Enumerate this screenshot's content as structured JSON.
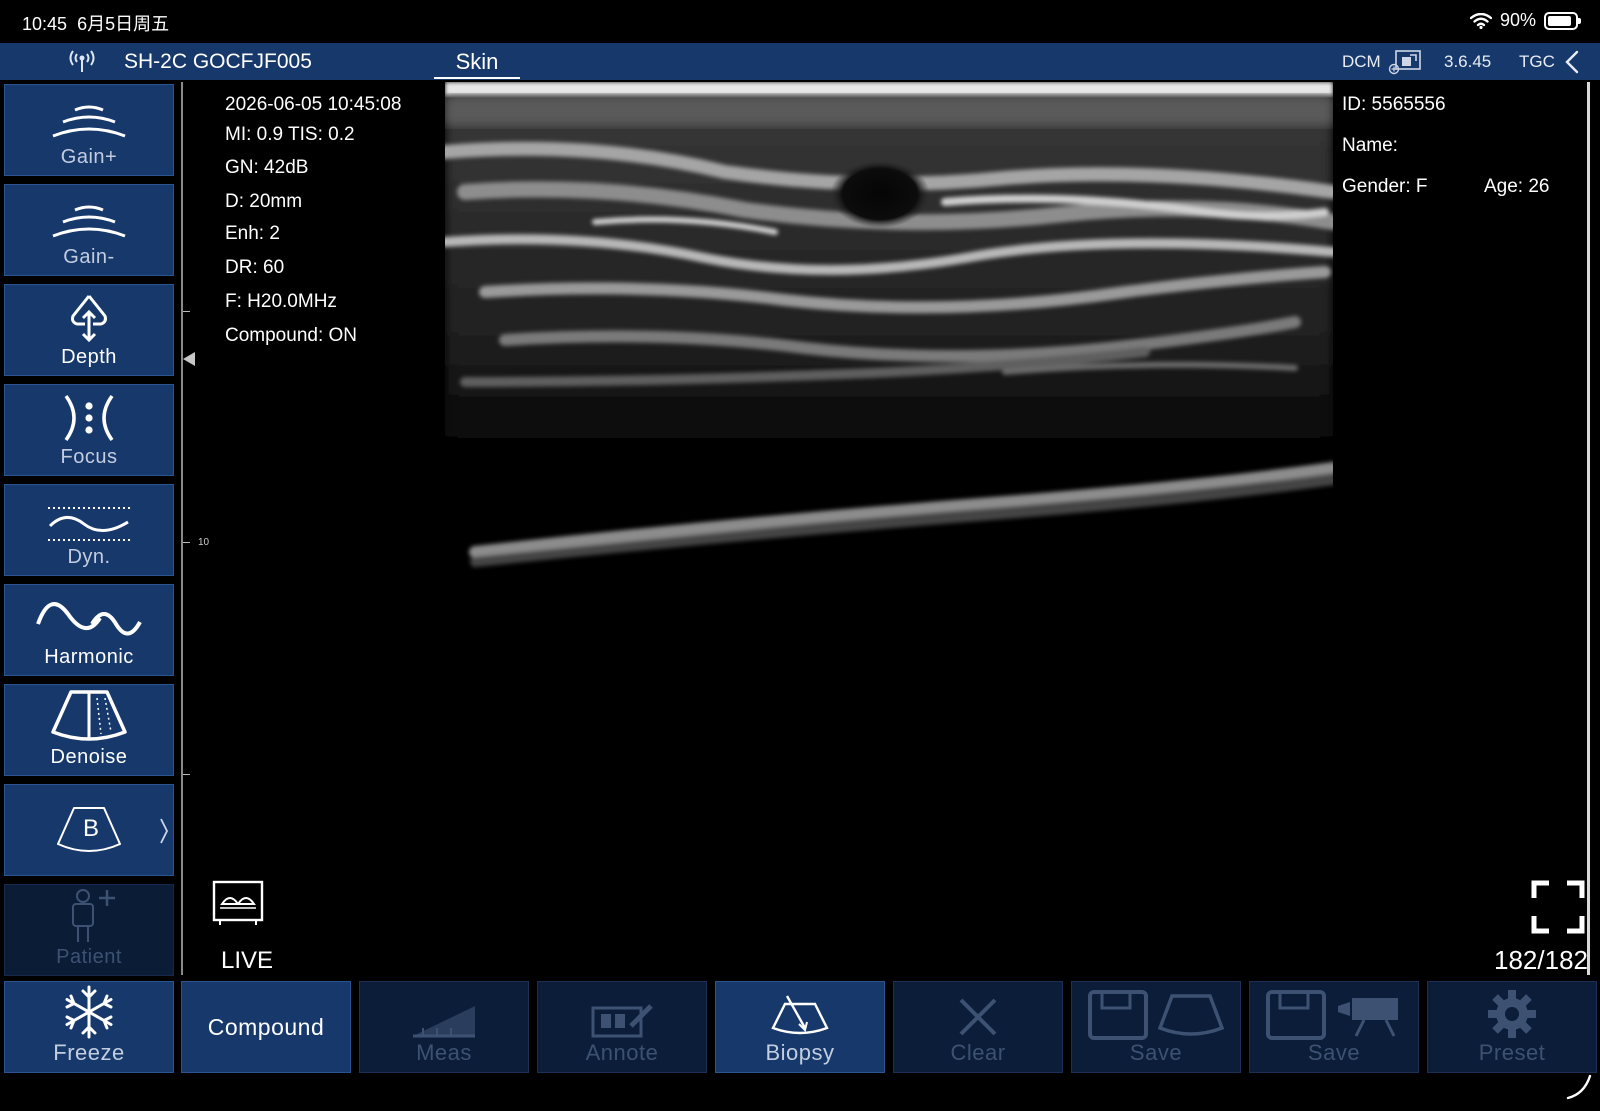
{
  "status_bar": {
    "time": "10:45",
    "date": "6月5日周五",
    "battery": "90%",
    "battery_level": 0.9
  },
  "header": {
    "device": "SH-2C GOCFJF005",
    "mode": "Skin",
    "dcm": "DCM",
    "version": "3.6.45",
    "tgc": "TGC"
  },
  "left_toolbar": {
    "gain_plus": "Gain+",
    "gain_minus": "Gain-",
    "depth": "Depth",
    "focus": "Focus",
    "dyn": "Dyn.",
    "harmonic": "Harmonic",
    "denoise": "Denoise",
    "bmode": "B",
    "patient": "Patient"
  },
  "scan_info": {
    "datetime": "2026-06-05 10:45:08",
    "mi_tis": "MI: 0.9  TIS: 0.2",
    "gain": "GN: 42dB",
    "depth": "D: 20mm",
    "enhance": "Enh: 2",
    "dynamic_range": "DR: 60",
    "frequency": "F: H20.0MHz",
    "compound": "Compound: ON"
  },
  "patient_info": {
    "id": "ID: 5565556",
    "name": "Name:",
    "gender": "Gender: F",
    "age": "Age: 26"
  },
  "depth_scale": {
    "tick_label": "10"
  },
  "live_label": "LIVE",
  "frame_count": "182/182",
  "bottom_toolbar": {
    "freeze": "Freeze",
    "compound": "Compound",
    "meas": "Meas",
    "annote": "Annote",
    "biopsy": "Biopsy",
    "clear": "Clear",
    "save_image": "Save",
    "save_video": "Save",
    "preset": "Preset"
  },
  "colors": {
    "accent": "#16386b",
    "disabled": "#0b1d38",
    "dim_text": "#3d5273"
  }
}
